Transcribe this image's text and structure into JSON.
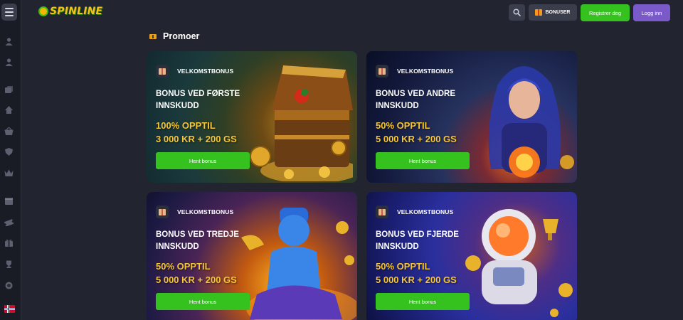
{
  "header": {
    "logo_text": "SPINLINE",
    "search_icon": "search-icon",
    "bonus_label": "BONUSER",
    "register_label": "Registrer deg",
    "login_label": "Logg inn"
  },
  "sidebar": {
    "icons": [
      "user-icon",
      "user-icon",
      "cards-icon",
      "casino-icon",
      "basket-icon",
      "shield-icon",
      "crown-icon",
      "calendar-icon",
      "ticket-icon",
      "gift-icon",
      "trophy-icon",
      "chip-icon"
    ],
    "flag": "norway-flag"
  },
  "main": {
    "section_title": "Promoer",
    "section_icon": "ticket-icon",
    "cards": [
      {
        "tag": "VELKOMSTBONUS",
        "title": "BONUS VED FØRSTE INNSKUDD",
        "offer_line1": "100% OPPTIL",
        "offer_line2": "3 000 KR + 200 GS",
        "button": "Hent bonus",
        "image": "treasure-chest-parrot"
      },
      {
        "tag": "VELKOMSTBONUS",
        "title": "BONUS VED ANDRE INNSKUDD",
        "offer_line1": "50% OPPTIL",
        "offer_line2": "5 000 KR + 200 GS",
        "button": "Hent bonus",
        "image": "sorceress-crystal-ball"
      },
      {
        "tag": "VELKOMSTBONUS",
        "title": "BONUS VED TREDJE INNSKUDD",
        "offer_line1": "50% OPPTIL",
        "offer_line2": "5 000 KR + 200 GS",
        "button": "Hent bonus",
        "image": "genie-lamp"
      },
      {
        "tag": "VELKOMSTBONUS",
        "title": "BONUS VED FJERDE INNSKUDD",
        "offer_line1": "50% OPPTIL",
        "offer_line2": "5 000 KR + 200 GS",
        "button": "Hent bonus",
        "image": "astronaut-trophy"
      }
    ]
  },
  "colors": {
    "background": "#222430",
    "sidebar": "#1a1c25",
    "accent_green": "#35c21f",
    "accent_purple": "#7a5ac9",
    "offer_gold": "#f7c531"
  }
}
